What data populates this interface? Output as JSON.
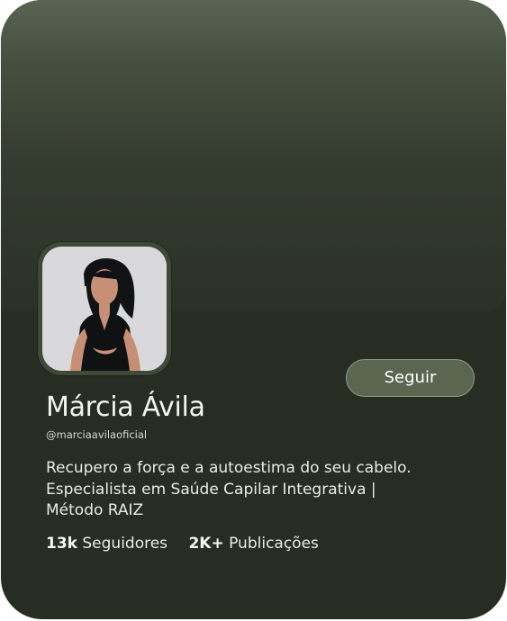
{
  "profile": {
    "name": "Márcia Ávila",
    "handle": "@marciaavilaoficial",
    "bio_lines": [
      "Recupero a força e a autoestima do seu cabelo.",
      "Especialista em Saúde Capilar Integrativa |",
      "Método RAIZ"
    ],
    "follow_button": "Seguir",
    "stats": [
      {
        "value": "13k",
        "label": "Seguidores"
      },
      {
        "value": "2K+",
        "label": "Publicações"
      }
    ],
    "avatar_icon": "profile-photo"
  },
  "colors": {
    "card_background": "#272d22",
    "cover_top": "#586350",
    "button_background": "#5a6650",
    "text_primary": "#f4f5f2"
  }
}
